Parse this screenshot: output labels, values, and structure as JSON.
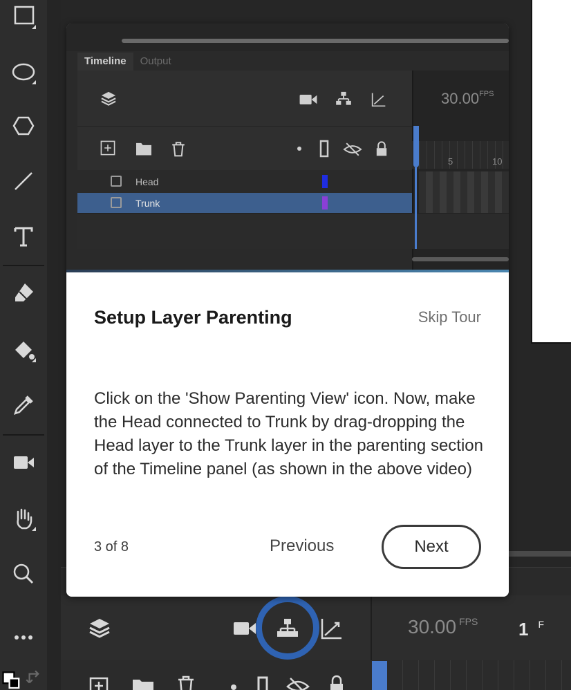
{
  "tour": {
    "title": "Setup Layer Parenting",
    "skip_label": "Skip Tour",
    "description": "Click on the 'Show Parenting View' icon. Now, make the Head connected to Trunk by drag-dropping the Head layer to the Trunk layer in the parenting section of the Timeline panel (as shown in the above video)",
    "step_indicator": "3 of 8",
    "previous_label": "Previous",
    "next_label": "Next"
  },
  "video": {
    "tabs": [
      "Timeline",
      "Output"
    ],
    "fps_value": "30.00",
    "fps_unit": "FPS",
    "ruler_numbers": [
      "5",
      "10"
    ],
    "layers": [
      {
        "name": "Head",
        "color": "#1f2de0",
        "selected": false
      },
      {
        "name": "Trunk",
        "color": "#8a3fd6",
        "selected": true
      }
    ]
  },
  "timeline": {
    "fps_value": "30.00",
    "fps_unit": "FPS",
    "frame_value": "1",
    "frame_unit": "F"
  },
  "colors": {
    "accent": "#2f63b3",
    "selection": "#3d5f8e",
    "playhead": "#4a7ccc"
  }
}
